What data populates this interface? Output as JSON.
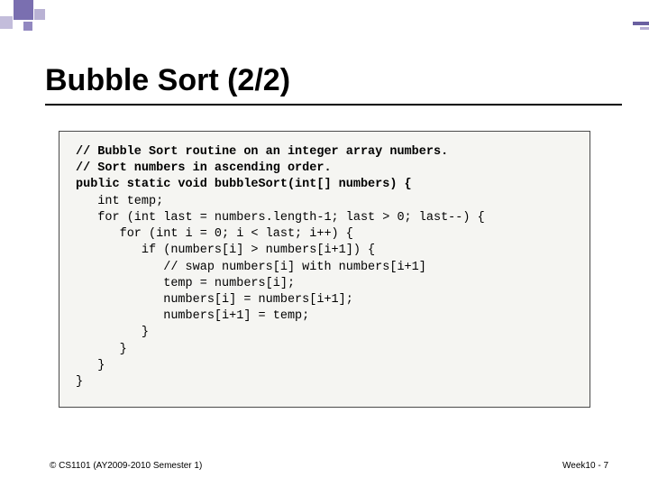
{
  "title": "Bubble Sort (2/2)",
  "code": {
    "header": "// Bubble Sort routine on an integer array numbers.\n// Sort numbers in ascending order.\npublic static void bubbleSort(int[] numbers) {",
    "body": "\n   int temp;\n   for (int last = numbers.length-1; last > 0; last--) {\n      for (int i = 0; i < last; i++) {\n         if (numbers[i] > numbers[i+1]) {\n            // swap numbers[i] with numbers[i+1]\n            temp = numbers[i];\n            numbers[i] = numbers[i+1];\n            numbers[i+1] = temp;\n         }\n      }\n   }\n}"
  },
  "footer": {
    "left": "© CS1101 (AY2009-2010 Semester 1)",
    "right": "Week10 - 7"
  }
}
